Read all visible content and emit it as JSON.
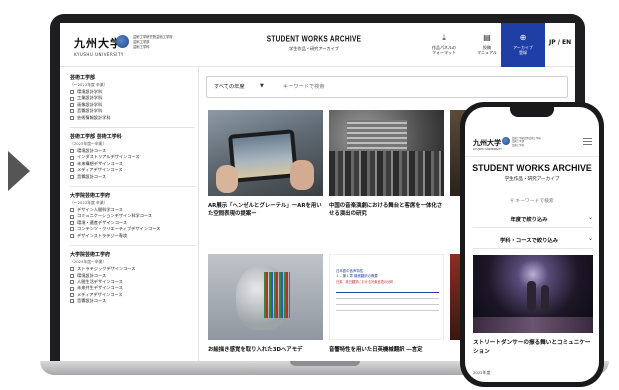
{
  "site": {
    "logo_jp": "九州大学",
    "logo_en": "KYUSHU UNIVERSITY",
    "faculty_lines": [
      "芸術工学研究院芸術工学府",
      "芸術工学部",
      "芸術工学科"
    ],
    "title_en": "STUDENT WORKS ARCHIVE",
    "title_jp": "学生作品・研究アーカイブ",
    "nav": [
      {
        "label": "作品パネルの\nフォーマット",
        "icon": "download-icon"
      },
      {
        "label": "投稿\nマニュアル",
        "icon": "document-icon"
      },
      {
        "label": "アーカイブ\n登録",
        "icon": "plus-circle-icon",
        "active": true
      }
    ],
    "lang": "JP / EN",
    "accent_color": "#1f3fa6"
  },
  "sidebar": {
    "groups": [
      {
        "title": "芸術工学部",
        "years": "（〜2022年度 卒業）",
        "items": [
          "環境設計学科",
          "工業設計学科",
          "画像設計学科",
          "音響設計学科",
          "芸術情報設計学科"
        ]
      },
      {
        "title": "芸術工学部 芸術工学科",
        "years": "（2023年度〜卒業）",
        "items": [
          "環境設計コース",
          "インダストリアルデザインコース",
          "未来構想デザインコース",
          "メディアデザインコース",
          "音響設計コース"
        ]
      },
      {
        "title": "大学院芸術工学府",
        "years": "（〜2022年度 卒業）",
        "items": [
          "デザイン人間科学コース",
          "コミュニケーションデザイン科学コース",
          "環境・遺産デザインコース",
          "コンテンツ・クリエーティブデザインコース",
          "デザインストラテジー専攻"
        ]
      },
      {
        "title": "大学院芸術工学府",
        "years": "（2023年度〜卒業）",
        "items": [
          "ストラテジックデザインコース",
          "環境設計コース",
          "人間生活デザインコース",
          "未来共生デザインコース",
          "メディアデザインコース",
          "音響設計コース"
        ]
      }
    ]
  },
  "filter": {
    "year_select": "すべての年度",
    "keyword_placeholder": "キーワードで検索"
  },
  "cards": [
    {
      "caption": "AR展示「ヘンゼルとグレーテル」ーARを用いた空間表現の提案ー"
    },
    {
      "caption": "中国の音楽演劇における舞台と客席を一体化させる演出の研究"
    },
    {
      "caption": "お絵描き感覚を取り入れた3Dヘアモデ"
    },
    {
      "caption": "音響特性を用いた日英機械翻訳 ―言定"
    }
  ],
  "doc_preview": {
    "heading": "日本語の音声特性",
    "subheading": "１．第１章 機械翻訳の概要",
    "red_note": "日英、英日翻訳における対象言語の分析"
  },
  "phone": {
    "logo_jp": "九州大学",
    "logo_en": "KYUSHU UNIVERSITY",
    "title_en": "STUDENT WORKS ARCHIVE",
    "title_jp": "学生作品・研究アーカイブ",
    "search_placeholder": "キーワードで検索",
    "filter_year": "年度で絞り込み",
    "filter_course": "学科・コースで絞り込み",
    "card_caption": "ストリートダンサーの振る舞いとコミュニケーション",
    "card_year": "2022年度"
  }
}
